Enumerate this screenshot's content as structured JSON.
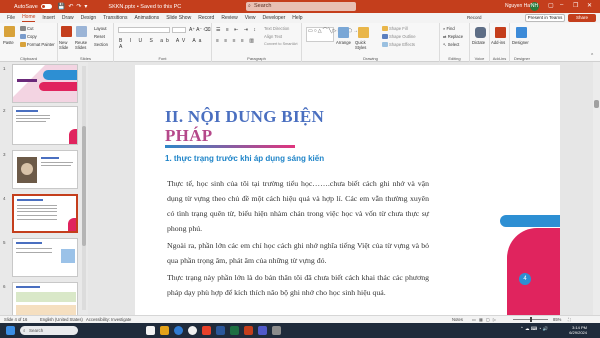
{
  "titlebar": {
    "autosave_label": "AutoSave",
    "autosave_state": "Off",
    "doc_title": "SKKN.pptx • Saved to this PC",
    "search_placeholder": "Search",
    "user_name": "Nguyen Hai",
    "user_initials": "NH"
  },
  "menu": [
    "File",
    "Home",
    "Insert",
    "Draw",
    "Design",
    "Transitions",
    "Animations",
    "Slide Show",
    "Record",
    "Review",
    "View",
    "Developer",
    "Help"
  ],
  "menu_active": "Home",
  "top_actions": {
    "record": "Record",
    "present": "Present in Teams",
    "share": "Share"
  },
  "ribbon": {
    "clipboard": {
      "paste": "Paste",
      "cut": "Cut",
      "copy": "Copy",
      "format_painter": "Format Painter",
      "label": "Clipboard"
    },
    "slides": {
      "new_slide": "New Slide",
      "reuse": "Reuse Slides",
      "layout": "Layout",
      "reset": "Reset",
      "section": "Section",
      "label": "Slides"
    },
    "font": {
      "label": "Font",
      "font_name": "",
      "font_size": "",
      "formats": "B I U S ab AV Aa A"
    },
    "paragraph": {
      "label": "Paragraph",
      "text_direction": "Text Direction",
      "align_text": "Align Text",
      "smartart": "Convert to SmartArt"
    },
    "drawing": {
      "label": "Drawing",
      "arrange": "Arrange",
      "quick_styles": "Quick Styles",
      "shape_fill": "Shape Fill",
      "shape_outline": "Shape Outline",
      "shape_effects": "Shape Effects"
    },
    "editing": {
      "label": "Editing",
      "find": "Find",
      "replace": "Replace",
      "select": "Select"
    },
    "voice": {
      "label": "Voice",
      "dictate": "Dictate"
    },
    "addins": {
      "label": "Add-ins",
      "addins": "Add-ins"
    },
    "designer": {
      "label": "Designer",
      "designer": "Designer"
    }
  },
  "thumbnails": [
    {
      "num": "1"
    },
    {
      "num": "2"
    },
    {
      "num": "3"
    },
    {
      "num": "4",
      "selected": true
    },
    {
      "num": "5"
    },
    {
      "num": "6"
    }
  ],
  "slide": {
    "title_line1": "II. NỘI DUNG BIỆN",
    "title_line2": "PHÁP",
    "subtitle": "1. thực trạng trước khi áp dụng sáng kiến",
    "para1": "Thực tế, học sinh của tôi tại trường tiểu học…….chưa biết cách ghi nhớ và vận dụng từ vựng theo chủ đề một cách hiệu quả và hợp lí. Các em vẫn thường xuyên có tình trạng quên từ, biểu hiện nhàm chán trong việc học và vốn từ chưa thực sự phong phú.",
    "para2": "Ngoài ra, phần lớn các em chỉ học cách ghi nhớ nghĩa tiếng Việt của từ vựng và bỏ qua phần trọng âm, phát âm của những từ vựng đó.",
    "para3": "Thực trạng này phần lớn là do bản thân tôi đã chưa biết cách khai thác các phương pháp dạy phù hợp để kích thích não bộ ghi nhớ cho học sinh hiệu quả.",
    "page_number": "4"
  },
  "status": {
    "slide_info": "Slide 4 of 16",
    "language": "English (United States)",
    "accessibility": "Accessibility: Investigate",
    "notes": "Notes",
    "zoom": "85%"
  },
  "taskbar": {
    "search": "Search",
    "time": "3:14 PM",
    "date": "6/29/2024"
  },
  "colors": {
    "accent": "#c43e1c",
    "title_blue": "#4a6fc0",
    "title_pink": "#b5488a",
    "subtitle_blue": "#1e84c8",
    "deco_blue": "#2d8fd3",
    "deco_pink": "#e0245e"
  }
}
